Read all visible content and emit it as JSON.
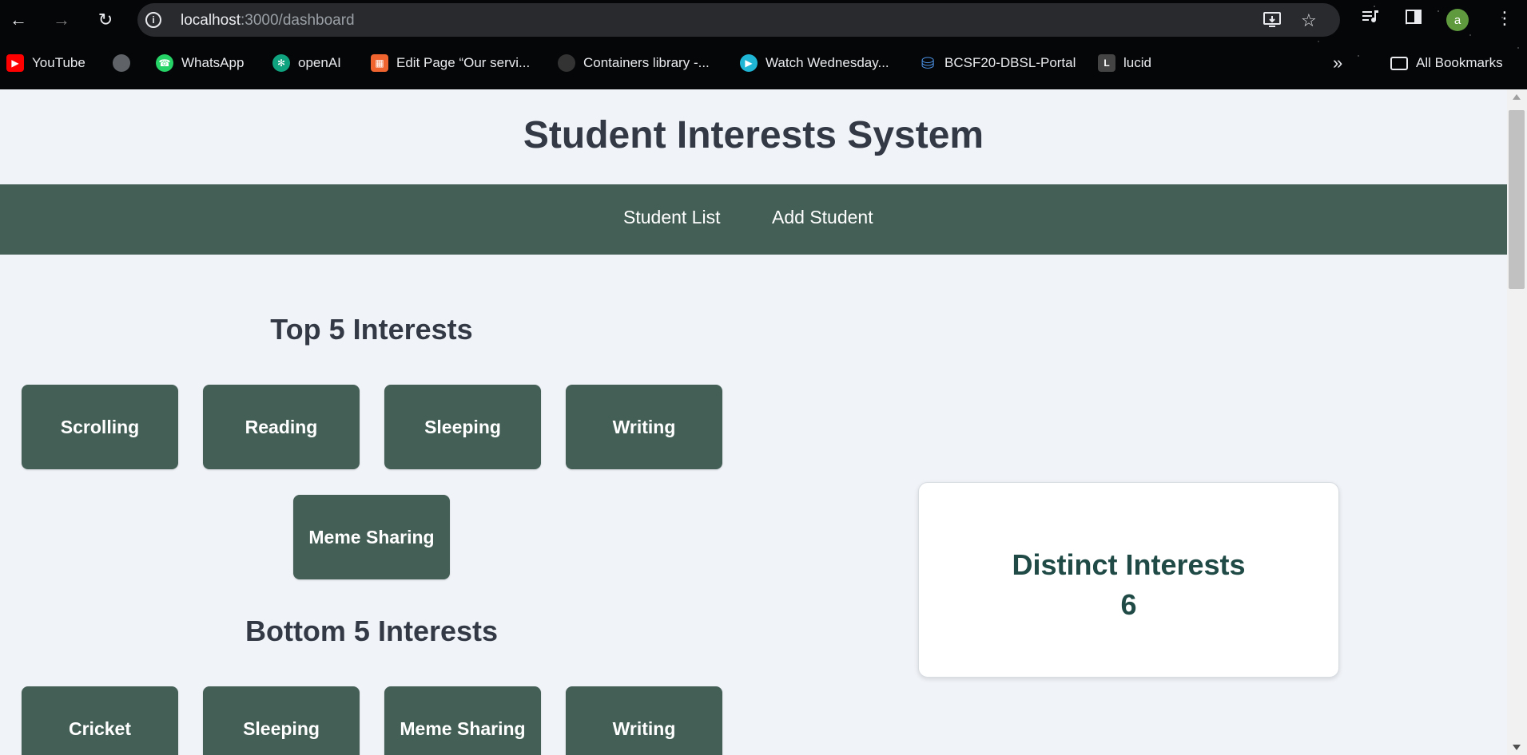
{
  "browser": {
    "url_host": "localhost",
    "url_path": ":3000/dashboard",
    "avatar_letter": "a",
    "bookmarks": [
      {
        "label": "YouTube",
        "icon": "youtube-icon",
        "color": "#ff0000"
      },
      {
        "label": "",
        "icon": "globe-icon",
        "color": "#5f6368"
      },
      {
        "label": "WhatsApp",
        "icon": "whatsapp-icon",
        "color": "#25d366"
      },
      {
        "label": "openAI",
        "icon": "openai-icon",
        "color": "#10a37f"
      },
      {
        "label": "Edit Page “Our servi...",
        "icon": "edit-page-icon",
        "color": "#f0652f"
      },
      {
        "label": "Containers library -...",
        "icon": "containers-icon",
        "color": "#333333"
      },
      {
        "label": "Watch Wednesday...",
        "icon": "play-icon",
        "color": "#1fb6d6"
      },
      {
        "label": "BCSF20-DBSL-Portal",
        "icon": "database-icon",
        "color": "#4a8fe0"
      },
      {
        "label": "lucid",
        "icon": "lucid-icon",
        "color": "#444444"
      }
    ],
    "all_bookmarks_label": "All Bookmarks"
  },
  "site": {
    "title": "Student Interests System",
    "nav": [
      "Student List",
      "Add Student"
    ]
  },
  "top_interests": {
    "title": "Top 5 Interests",
    "items": [
      "Scrolling",
      "Reading",
      "Sleeping",
      "Writing",
      "Meme Sharing"
    ]
  },
  "bottom_interests": {
    "title": "Bottom 5 Interests",
    "items": [
      "Cricket",
      "Sleeping",
      "Meme Sharing",
      "Writing"
    ]
  },
  "stats": {
    "label": "Distinct Interests",
    "value": "6"
  },
  "colors": {
    "accent": "#445f56",
    "stat_text": "#1f4a45"
  }
}
